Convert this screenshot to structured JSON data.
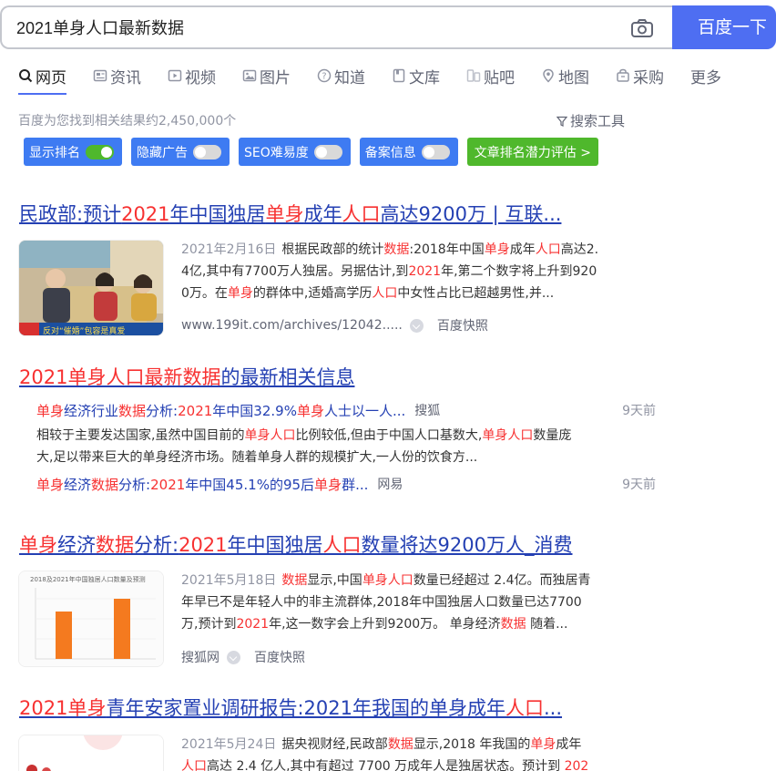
{
  "search": {
    "query": "2021单身人口最新数据",
    "button_label": "百度一下"
  },
  "tabs": [
    {
      "label": "网页",
      "icon": "search-icon",
      "active": true
    },
    {
      "label": "资讯",
      "icon": "news-icon"
    },
    {
      "label": "视频",
      "icon": "video-icon"
    },
    {
      "label": "图片",
      "icon": "image-icon"
    },
    {
      "label": "知道",
      "icon": "question-icon"
    },
    {
      "label": "文库",
      "icon": "document-icon"
    },
    {
      "label": "贴吧",
      "icon": "tieba-icon"
    },
    {
      "label": "地图",
      "icon": "map-icon"
    },
    {
      "label": "采购",
      "icon": "cart-icon"
    },
    {
      "label": "更多"
    }
  ],
  "result_count": "百度为您找到相关结果约2,450,000个",
  "search_tools": "搜索工具",
  "plugins": [
    {
      "label": "显示排名",
      "on": true
    },
    {
      "label": "隐藏广告",
      "on": false
    },
    {
      "label": "SEO难易度",
      "on": false
    },
    {
      "label": "备案信息",
      "on": false
    },
    {
      "label": "文章排名潜力评估 >"
    }
  ],
  "colors": {
    "accent": "#4e6ef2",
    "link": "#2440b3",
    "highlight": "#f73131",
    "plugin_blue": "#3e7bf2",
    "plugin_green": "#4fb82c"
  },
  "results": [
    {
      "title": [
        {
          "t": "民政部:预计"
        },
        {
          "t": "2021",
          "hl": true
        },
        {
          "t": "年中国独居"
        },
        {
          "t": "单身",
          "hl": true
        },
        {
          "t": "成年"
        },
        {
          "t": "人口",
          "hl": true
        },
        {
          "t": "高达9200万 | 互联..."
        }
      ],
      "date": "2021年2月16日",
      "abstract_lines": [
        [
          {
            "t": "根据民政部的统计"
          },
          {
            "t": "数据",
            "hl": true
          },
          {
            "t": ":2018年中国"
          },
          {
            "t": "单身",
            "hl": true
          },
          {
            "t": "成年"
          },
          {
            "t": "人口",
            "hl": true
          },
          {
            "t": "高达2."
          }
        ],
        [
          {
            "t": "4亿,其中有7700万人独居。另据估计,到"
          },
          {
            "t": "2021",
            "hl": true
          },
          {
            "t": "年,第二个数字将上升到920"
          }
        ],
        [
          {
            "t": "0万。在"
          },
          {
            "t": "单身",
            "hl": true
          },
          {
            "t": "的群体中,适婚高学历"
          },
          {
            "t": "人口",
            "hl": true
          },
          {
            "t": "中女性占比已超越男性,并..."
          }
        ]
      ],
      "source": "www.199it.com/archives/12042.....",
      "snapshot": "百度快照",
      "thumb_caption": "反对“催婚”包容是真爱"
    },
    {
      "title": [
        {
          "t": "2021单身人口最新数据",
          "hl": true
        },
        {
          "t": "的最新相关信息"
        }
      ],
      "news": [
        {
          "title": [
            {
              "t": "单身",
              "hl": true
            },
            {
              "t": "经济行业"
            },
            {
              "t": "数据",
              "hl": true
            },
            {
              "t": "分析:"
            },
            {
              "t": "2021",
              "hl": true
            },
            {
              "t": "年中国32.9%"
            },
            {
              "t": "单身",
              "hl": true
            },
            {
              "t": "人士以一人..."
            }
          ],
          "source": "搜狐",
          "ago": "9天前",
          "desc_lines": [
            [
              {
                "t": "相较于主要发达国家,虽然中国目前的"
              },
              {
                "t": "单身人口",
                "hl": true
              },
              {
                "t": "比例较低,但由于中国人口基数大,"
              },
              {
                "t": "单身人口",
                "hl": true
              },
              {
                "t": "数量庞"
              }
            ],
            [
              {
                "t": "大,足以带来巨大的单身经济市场。随着单身人群的规模扩大,一人份的饮食方..."
              }
            ]
          ]
        },
        {
          "title": [
            {
              "t": "单身",
              "hl": true
            },
            {
              "t": "经济"
            },
            {
              "t": "数据",
              "hl": true
            },
            {
              "t": "分析:"
            },
            {
              "t": "2021",
              "hl": true
            },
            {
              "t": "年中国45.1%的95后"
            },
            {
              "t": "单身",
              "hl": true
            },
            {
              "t": "群..."
            }
          ],
          "source": "网易",
          "ago": "9天前"
        }
      ]
    },
    {
      "title": [
        {
          "t": "单身",
          "hl": true
        },
        {
          "t": "经济"
        },
        {
          "t": "数据",
          "hl": true
        },
        {
          "t": "分析:"
        },
        {
          "t": "2021",
          "hl": true
        },
        {
          "t": "年中国独居"
        },
        {
          "t": "人口",
          "hl": true
        },
        {
          "t": "数量将达9200万人_消费"
        }
      ],
      "date": "2021年5月18日",
      "abstract_lines": [
        [
          {
            "t": "数据",
            "hl": true
          },
          {
            "t": "显示,中国"
          },
          {
            "t": "单身人口",
            "hl": true
          },
          {
            "t": "数量已经超过 2.4亿。而独居青"
          }
        ],
        [
          {
            "t": "年早已不是年轻人中的非主流群体,2018年中国独居人口数量已达7700"
          }
        ],
        [
          {
            "t": "万,预计到"
          },
          {
            "t": "2021",
            "hl": true
          },
          {
            "t": "年,这一数字会上升到9200万。 单身经济"
          },
          {
            "t": "数据",
            "hl": true
          },
          {
            "t": " 随着..."
          }
        ]
      ],
      "source": "搜狐网",
      "snapshot": "百度快照",
      "thumb_caption": "2018及2021年中国独居人口数量及预测"
    },
    {
      "title": [
        {
          "t": "2021单身",
          "hl": true
        },
        {
          "t": "青年安家置业调研报告:2021年我国的单身成年"
        },
        {
          "t": "人口",
          "hl": true
        },
        {
          "t": "..."
        }
      ],
      "date": "2021年5月24日",
      "abstract_lines": [
        [
          {
            "t": "据央视财经,民政部"
          },
          {
            "t": "数据",
            "hl": true
          },
          {
            "t": "显示,2018 年我国的"
          },
          {
            "t": "单身",
            "hl": true
          },
          {
            "t": "成年"
          }
        ],
        [
          {
            "t": "人口",
            "hl": true
          },
          {
            "t": "高达 2.4 亿人,其中有超过 7700 万成年人是独居状态。预计到 "
          },
          {
            "t": "202",
            "hl": true
          }
        ]
      ]
    }
  ]
}
